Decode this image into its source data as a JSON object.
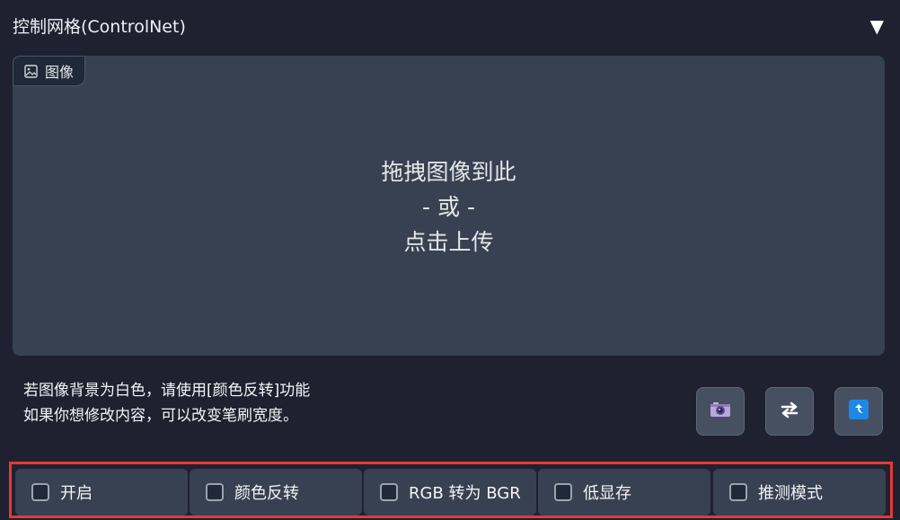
{
  "header": {
    "title": "控制网格(ControlNet)",
    "toggle_symbol": "▼"
  },
  "image_panel": {
    "tab_label": "图像",
    "tab_icon": "image-icon",
    "drop_line1": "拖拽图像到此",
    "drop_line2": "- 或 -",
    "drop_line3": "点击上传"
  },
  "hint": {
    "line1": "若图像背景为白色，请使用[颜色反转]功能",
    "line2": "如果你想修改内容，可以改变笔刷宽度。"
  },
  "toolbar": {
    "buttons": [
      {
        "icon": "camera-icon"
      },
      {
        "icon": "swap-arrows-icon"
      },
      {
        "icon": "send-up-icon"
      }
    ]
  },
  "options": [
    {
      "label": "开启",
      "checked": false
    },
    {
      "label": "颜色反转",
      "checked": false
    },
    {
      "label": "RGB 转为 BGR",
      "checked": false
    },
    {
      "label": "低显存",
      "checked": false
    },
    {
      "label": "推测模式",
      "checked": false
    }
  ],
  "colors": {
    "background": "#1f2130",
    "panel": "#374151",
    "highlight_border": "#e53935",
    "send_icon_blue": "#1e88e5"
  }
}
